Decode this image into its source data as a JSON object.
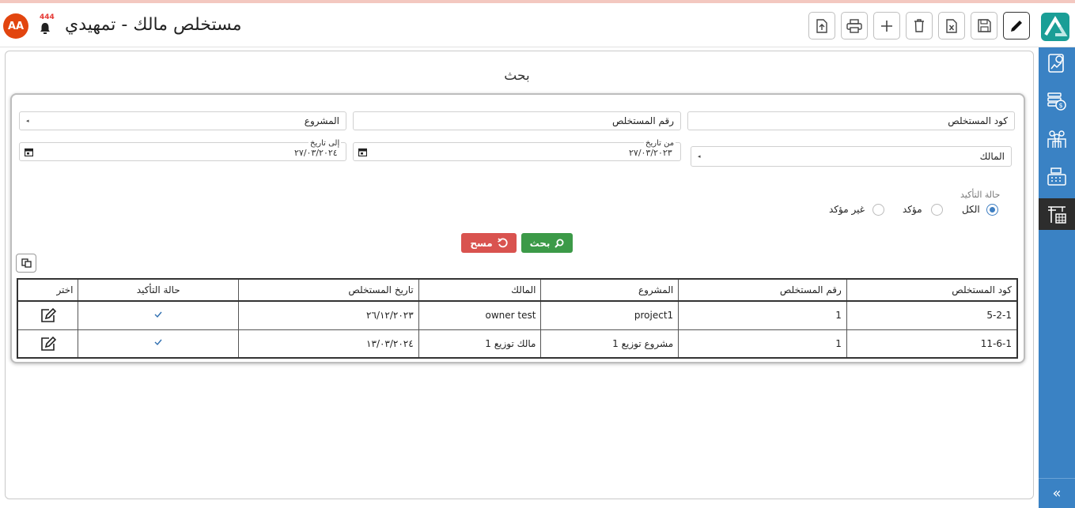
{
  "header": {
    "title": "مستخلص مالك - تمهيدي",
    "avatar_initials": "AA",
    "notification_count": "444"
  },
  "toolbar": {
    "buttons": [
      "edit",
      "save",
      "excel",
      "delete",
      "add",
      "print",
      "upload"
    ]
  },
  "search": {
    "title": "بحث",
    "fields": {
      "claim_code": "كود المستخلص",
      "claim_number": "رقم المستخلص",
      "project": "المشروع",
      "owner": "المالك",
      "from_date_label": "من تاريخ",
      "from_date_value": "٢٧/٠٣/٢٠٢٣",
      "to_date_label": "إلى تاريخ",
      "to_date_value": "٢٧/٠٣/٢٠٢٤"
    },
    "confirmation": {
      "label": "حالة التأكيد",
      "options": [
        "الكل",
        "مؤكد",
        "غير مؤكد"
      ],
      "selected": "الكل"
    },
    "buttons": {
      "search": "بحث",
      "clear": "مسح"
    }
  },
  "table": {
    "columns": [
      "كود المستخلص",
      "رقم المستخلص",
      "المشروع",
      "المالك",
      "تاريخ المستخلص",
      "حالة التأكيد",
      "اختر"
    ],
    "rows": [
      {
        "code": "5-2-1",
        "number": "1",
        "project": "project1",
        "owner": "owner test",
        "date": "٢٦/١٢/٢٠٢٣",
        "confirmed": true
      },
      {
        "code": "11-6-1",
        "number": "1",
        "project": "مشروع توزيع 1",
        "owner": "مالك توزيع 1",
        "date": "١٣/٠٣/٢٠٢٤",
        "confirmed": true
      }
    ]
  },
  "colors": {
    "sidebar": "#3a82c4",
    "search_button": "#3c9a48",
    "clear_button": "#d9534f",
    "avatar": "#e2450f",
    "logo": "#1a9e96"
  }
}
